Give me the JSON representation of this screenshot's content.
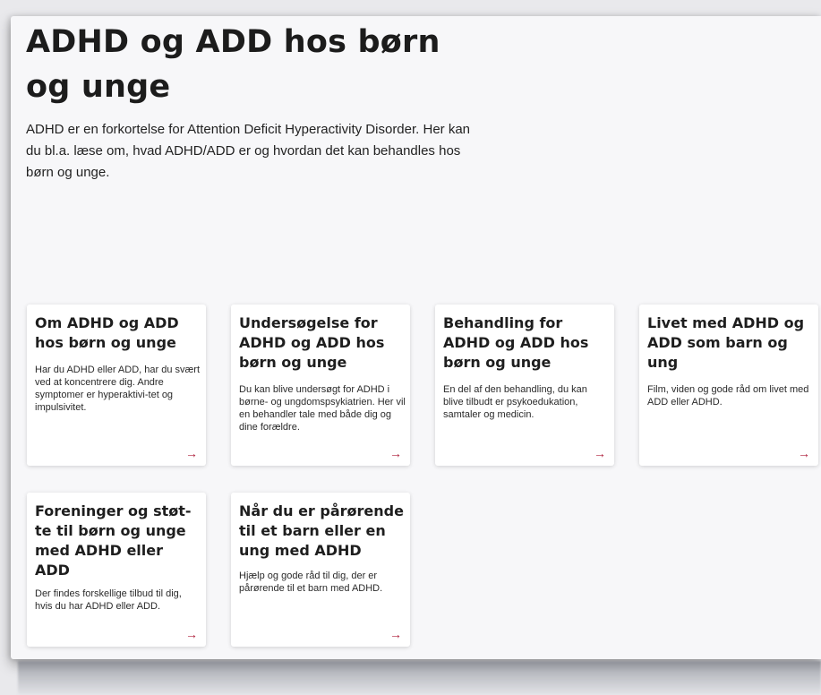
{
  "page": {
    "title": "ADHD og ADD hos børn og unge",
    "intro": "ADHD er en forkortelse for Attention Deficit Hyperactivity Disorder. Her kan du bl.a. læse om, hvad ADHD/ADD er og hvordan det kan behandles hos børn og unge."
  },
  "cards": [
    {
      "title": "Om ADHD og ADD hos børn og unge",
      "text": "Har du ADHD eller ADD, har du svært ved at koncentrere dig. Andre symptomer er hyperaktivi-tet og impulsivitet.",
      "arrow": "→"
    },
    {
      "title": "Undersøgelse for ADHD og ADD hos børn og unge",
      "text": "Du kan blive undersøgt for ADHD i børne- og ungdomspsykiatrien. Her vil en behandler tale med både dig og dine forældre.",
      "arrow": "→"
    },
    {
      "title": "Behandling for ADHD og ADD hos børn og unge",
      "text": "En del af den behandling, du kan blive tilbudt er psykoedukation, samtaler og medicin.",
      "arrow": "→"
    },
    {
      "title": "Livet med ADHD og ADD som barn og ung",
      "text": "Film, viden og gode råd om livet med ADD eller ADHD.",
      "arrow": "→"
    },
    {
      "title": "Foreninger og støt-te til børn og unge med ADHD eller ADD",
      "text": "Der findes forskellige tilbud til dig, hvis du har ADHD eller ADD.",
      "arrow": "→"
    },
    {
      "title": "Når du er pårørende til et barn eller en ung med ADHD",
      "text": "Hjælp og gode råd til dig, der er pårørende til et barn med ADHD.",
      "arrow": "→"
    }
  ],
  "colors": {
    "arrow_accent": "#b0223e",
    "card_background": "#ffffff",
    "page_background": "#f7f7f9"
  },
  "icons": {
    "arrow": "arrow-right-icon"
  }
}
